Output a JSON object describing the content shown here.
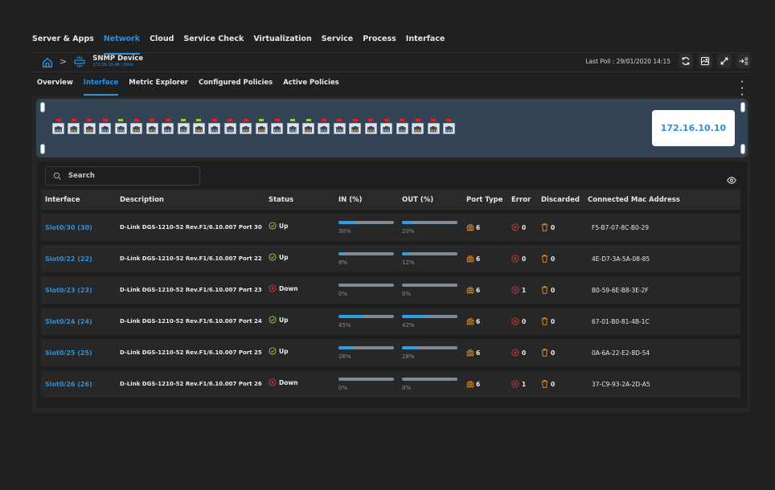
{
  "top_nav": {
    "tabs": [
      {
        "label": "Server & Apps",
        "active": false
      },
      {
        "label": "Network",
        "active": true
      },
      {
        "label": "Cloud",
        "active": false
      },
      {
        "label": "Service Check",
        "active": false
      },
      {
        "label": "Virtualization",
        "active": false
      },
      {
        "label": "Service",
        "active": false
      },
      {
        "label": "Process",
        "active": false
      },
      {
        "label": "Interface",
        "active": false
      }
    ]
  },
  "breadcrumb": {
    "home_icon": "home-icon",
    "separator": ">",
    "device_icon": "snmp-device-icon",
    "device_name": "SNMP Device",
    "device_sub": "172.16.10.48 | Dlink"
  },
  "toolbar": {
    "last_poll": "Last Poll :  29/01/2020 14:15",
    "buttons": [
      "refresh-icon",
      "image-icon",
      "expand-icon",
      "collapse-panel-icon"
    ]
  },
  "sub_nav": {
    "tabs": [
      {
        "label": "Overview",
        "active": false
      },
      {
        "label": "Interface",
        "active": true
      },
      {
        "label": "Metric Explorer",
        "active": false
      },
      {
        "label": "Configured Policies",
        "active": false
      },
      {
        "label": "Active Policies",
        "active": false
      }
    ],
    "more_icon": "kebab-menu-icon"
  },
  "switch_panel": {
    "ip": "172.16.10.10",
    "ports": [
      "down",
      "down",
      "down",
      "down",
      "up",
      "down",
      "down",
      "down",
      "up",
      "up",
      "down",
      "down",
      "down",
      "up",
      "down",
      "up",
      "up",
      "down",
      "down",
      "down",
      "down",
      "down",
      "down",
      "down",
      "down",
      "down"
    ]
  },
  "search": {
    "placeholder": "Search",
    "value": ""
  },
  "table": {
    "columns": [
      "Interface",
      "Description",
      "Status",
      "IN (%)",
      "OUT (%)",
      "Port Type",
      "Error",
      "Discarded",
      "Connected Mac Address"
    ],
    "rows": [
      {
        "interface": "Slot0/30 (30)",
        "description": "D-Link DGS-1210-52 Rev.F1/6.10.007 Port 30",
        "status": "Up",
        "in_pct": 30,
        "in_label": "30%",
        "out_pct": 20,
        "out_label": "20%",
        "port_type": "6",
        "error": "0",
        "discarded": "0",
        "mac": "F5-B7-07-8C-B0-29"
      },
      {
        "interface": "Slot0/22 (22)",
        "description": "D-Link DGS-1210-52 Rev.F1/6.10.007 Port 22",
        "status": "Up",
        "in_pct": 8,
        "in_label": "8%",
        "out_pct": 12,
        "out_label": "12%",
        "port_type": "6",
        "error": "0",
        "discarded": "0",
        "mac": "4E-D7-3A-5A-08-85"
      },
      {
        "interface": "Slot0/23 (23)",
        "description": "D-Link DGS-1210-52 Rev.F1/6.10.007 Port 23",
        "status": "Down",
        "in_pct": 0,
        "in_label": "0%",
        "out_pct": 0,
        "out_label": "0%",
        "port_type": "6",
        "error": "1",
        "discarded": "0",
        "mac": "B0-59-6E-B8-3E-2F"
      },
      {
        "interface": "Slot0/24 (24)",
        "description": "D-Link DGS-1210-52 Rev.F1/6.10.007 Port 24",
        "status": "Up",
        "in_pct": 45,
        "in_label": "45%",
        "out_pct": 42,
        "out_label": "42%",
        "port_type": "6",
        "error": "0",
        "discarded": "0",
        "mac": "67-01-B0-81-4B-1C"
      },
      {
        "interface": "Slot0/25 (25)",
        "description": "D-Link DGS-1210-52 Rev.F1/6.10.007 Port 25",
        "status": "Up",
        "in_pct": 26,
        "in_label": "26%",
        "out_pct": 28,
        "out_label": "28%",
        "port_type": "6",
        "error": "0",
        "discarded": "0",
        "mac": "0A-6A-22-E2-8D-54"
      },
      {
        "interface": "Slot0/26 (26)",
        "description": "D-Link DGS-1210-52 Rev.F1/6.10.007 Port 26",
        "status": "Down",
        "in_pct": 0,
        "in_label": "0%",
        "out_pct": 0,
        "out_label": "0%",
        "port_type": "6",
        "error": "1",
        "discarded": "0",
        "mac": "37-C9-93-2A-2D-A5"
      }
    ]
  },
  "colors": {
    "accent": "#2f8fd8",
    "status_up": "#8fd23a",
    "status_down": "#d23a32",
    "port_icon": "#e08a2a",
    "bar_fill": "#2f9ee0",
    "bar_track": "#7d8a99"
  }
}
